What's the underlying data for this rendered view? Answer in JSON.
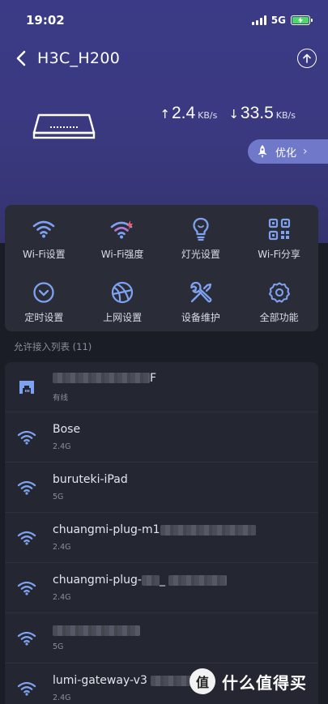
{
  "status": {
    "time": "19:02",
    "network": "5G"
  },
  "nav": {
    "title": "H3C_H200"
  },
  "speeds": {
    "upload_value": "2.4",
    "upload_unit": "KB/s",
    "download_value": "33.5",
    "download_unit": "KB/s"
  },
  "optimize": {
    "label": "优化"
  },
  "quick_actions": [
    {
      "label": "Wi-Fi设置",
      "icon": "wifi-icon"
    },
    {
      "label": "Wi-Fi强度",
      "icon": "wifi-boost-icon"
    },
    {
      "label": "灯光设置",
      "icon": "lightbulb-icon"
    },
    {
      "label": "Wi-Fi分享",
      "icon": "qr-code-icon"
    },
    {
      "label": "定时设置",
      "icon": "clock-icon"
    },
    {
      "label": "上网设置",
      "icon": "globe-icon"
    },
    {
      "label": "设备维护",
      "icon": "wrench-icon"
    },
    {
      "label": "全部功能",
      "icon": "gear-icon"
    }
  ],
  "device_list": {
    "header": "允许接入列表 (11)",
    "items": [
      {
        "name": "F",
        "sub": "有线",
        "icon": "ethernet-icon"
      },
      {
        "name": "Bose",
        "sub": "2.4G",
        "icon": "wifi-icon"
      },
      {
        "name": "buruteki-iPad",
        "sub": "5G",
        "icon": "wifi-icon"
      },
      {
        "name": "chuangmi-plug-m1",
        "sub": "2.4G",
        "icon": "wifi-icon"
      },
      {
        "name": "chuangmi-plug-",
        "name_suffix": "_",
        "sub": "2.4G",
        "icon": "wifi-icon"
      },
      {
        "name": "",
        "sub": "5G",
        "icon": "wifi-icon"
      },
      {
        "name": "lumi-gateway-v3",
        "sub": "2.4G",
        "icon": "wifi-icon"
      }
    ]
  },
  "watermark": {
    "text": "什么值得买",
    "logo_glyph": "值"
  },
  "colors": {
    "hero_bg": "#3b3a86",
    "panel_bg": "#2a2c38",
    "accent_blue": "#7ea2f0",
    "optimize_bg": "#6f78c9",
    "battery_green": "#4cd964"
  }
}
